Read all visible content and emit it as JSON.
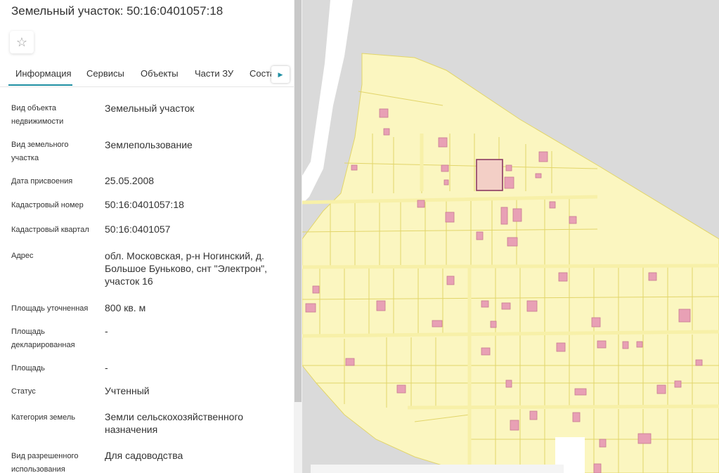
{
  "header": {
    "title": "Земельный участок: 50:16:0401057:18",
    "favorite_icon": "star-icon"
  },
  "tabs": [
    {
      "label": "Информация",
      "active": true
    },
    {
      "label": "Сервисы",
      "active": false
    },
    {
      "label": "Объекты",
      "active": false
    },
    {
      "label": "Части ЗУ",
      "active": false
    },
    {
      "label": "Соста",
      "active": false
    }
  ],
  "tabs_scroll_icon": "chevron-right-icon",
  "fields": [
    {
      "label": "Вид объекта недвижимости",
      "value": "Земельный участок"
    },
    {
      "label": "Вид земельного участка",
      "value": "Землепользование"
    },
    {
      "label": "Дата присвоения",
      "value": "25.05.2008"
    },
    {
      "label": "Кадастровый номер",
      "value": "50:16:0401057:18"
    },
    {
      "label": "Кадастровый квартал",
      "value": "50:16:0401057"
    },
    {
      "label": "Адрес",
      "value": "обл. Московская, р-н Ногинский, д. Большое Буньково, снт \"Электрон\", участок 16"
    },
    {
      "label": "Площадь уточненная",
      "value": "800 кв. м"
    },
    {
      "label": "Площадь декларированная",
      "value": "-"
    },
    {
      "label": "Площадь",
      "value": "-"
    },
    {
      "label": "Статус",
      "value": "Учтенный"
    },
    {
      "label": "Категория земель",
      "value": "Земли сельскохозяйственного назначения"
    },
    {
      "label": "Вид разрешенного использования",
      "value": "Для садоводства"
    }
  ],
  "map": {
    "background_color": "#dadada",
    "parcel_fill": "#fbf6c0",
    "parcel_stroke": "#e2d56a",
    "building_fill": "#e8a0b5",
    "building_stroke": "#c77b92",
    "selected_fill": "#f3cfc6",
    "selected_stroke": "#8b3a62",
    "road_color": "#ffffff"
  }
}
